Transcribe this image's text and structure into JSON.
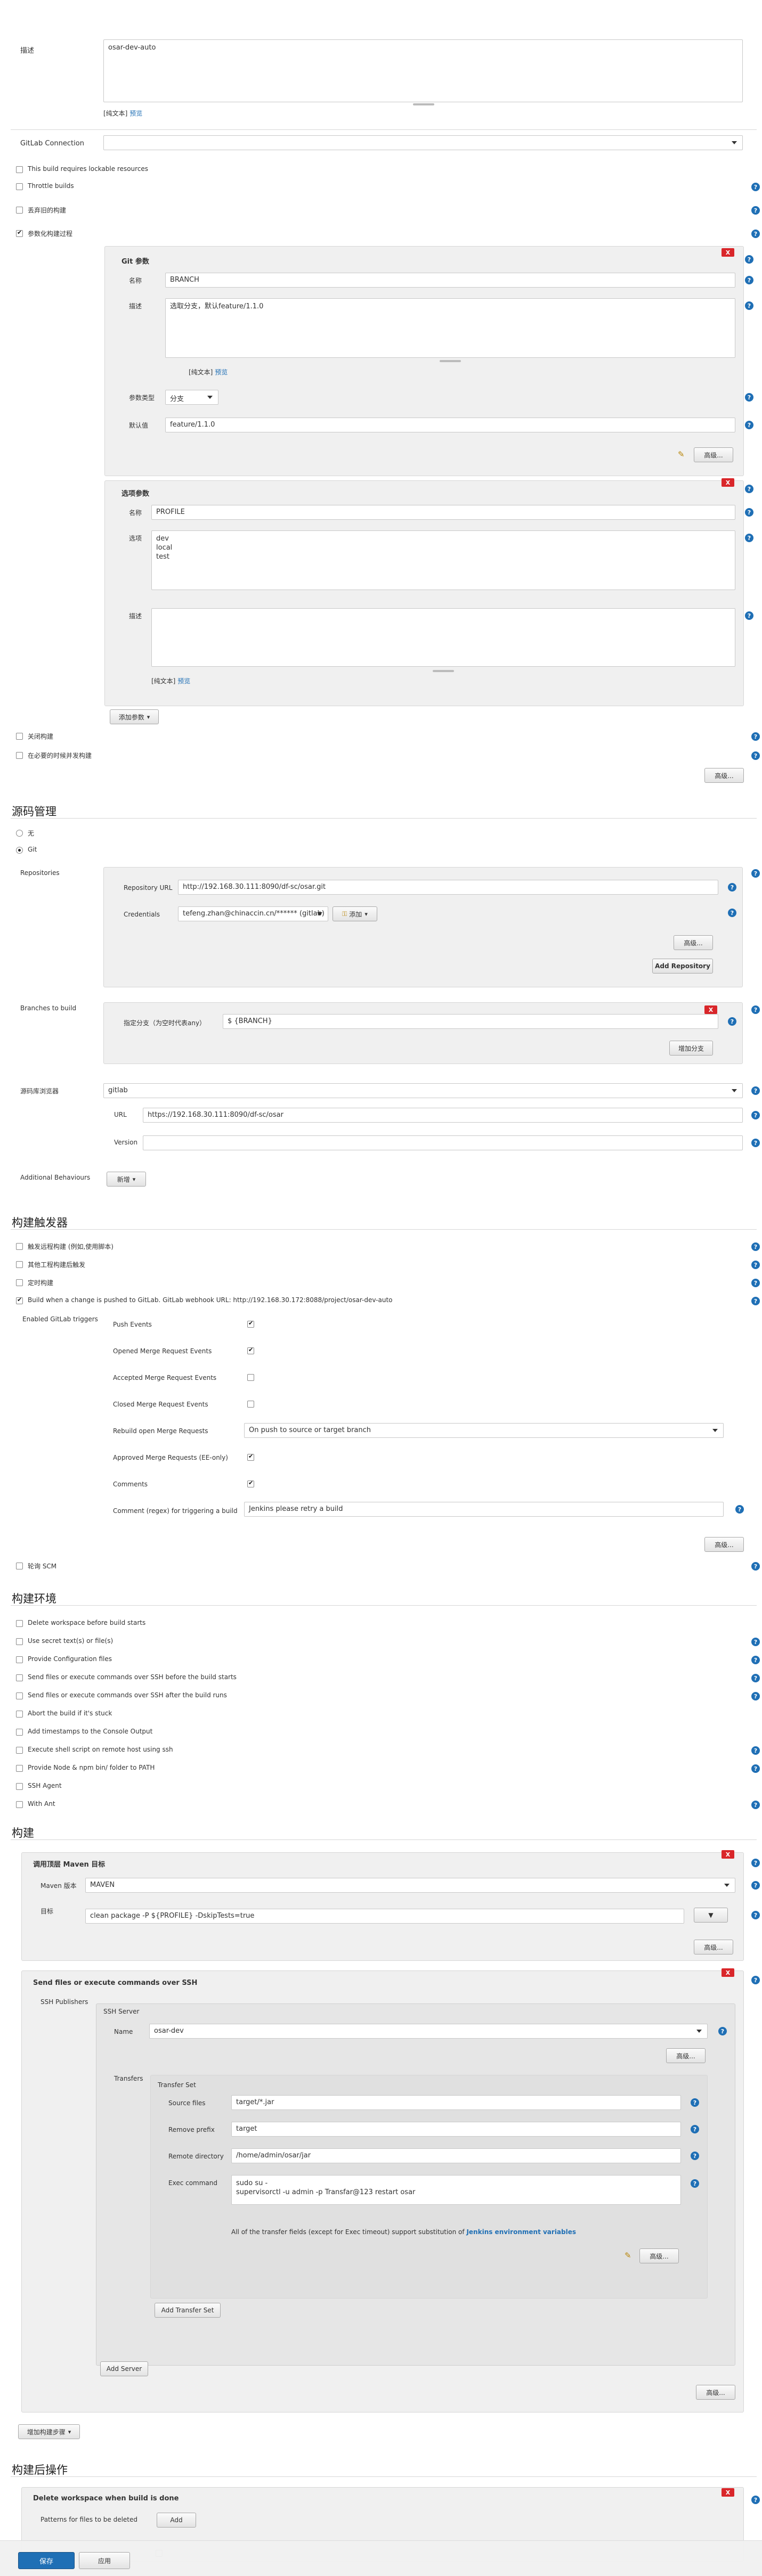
{
  "desc": {
    "label": "描述",
    "value": "osar-dev-auto",
    "plain_text": "[纯文本]",
    "preview": "预览"
  },
  "gitlab_connection": {
    "label": "GitLab Connection",
    "value": ""
  },
  "options": [
    "This build requires lockable resources",
    "Throttle builds",
    "丢弃旧的构建",
    "参数化构建过程"
  ],
  "git_param": {
    "title": "Git 参数",
    "name_label": "名称",
    "name_value": "BRANCH",
    "desc_label": "描述",
    "desc_value": "选取分支，默认feature/1.1.0",
    "plain_text": "[纯文本]",
    "preview": "预览",
    "type_label": "参数类型",
    "type_value": "分支",
    "default_label": "默认值",
    "default_value": "feature/1.1.0",
    "advanced": "高级..."
  },
  "choice_param": {
    "title": "选项参数",
    "name_label": "名称",
    "name_value": "PROFILE",
    "choices_label": "选项",
    "choices_value": "dev\nlocal\ntest",
    "desc_label": "描述",
    "plain_text": "[纯文本]",
    "preview": "预览"
  },
  "add_param": "添加参数",
  "options2": [
    "关闭构建",
    "在必要的时候并发构建"
  ],
  "advanced": "高级...",
  "scm": {
    "heading": "源码管理",
    "none": "无",
    "git": "Git",
    "repositories": "Repositories",
    "repo_url_label": "Repository URL",
    "repo_url": "http://192.168.30.111:8090/df-sc/osar.git",
    "credentials_label": "Credentials",
    "credentials_value": "tefeng.zhan@chinaccin.cn/****** (gitlab)",
    "add_credentials": "添加",
    "add_repository": "Add Repository",
    "branches": "Branches to build",
    "branch_label": "指定分支（为空时代表any）",
    "branch_value": "$ {BRANCH}",
    "add_branch": "增加分支",
    "browser_label": "源码库浏览器",
    "browser_value": "gitlab",
    "url_label": "URL",
    "url_value": "https://192.168.30.111:8090/df-sc/osar",
    "version_label": "Version",
    "additional": "Additional Behaviours",
    "add_behaviour": "新增"
  },
  "triggers": {
    "heading": "构建触发器",
    "items": [
      "触发远程构建 (例如,使用脚本)",
      "其他工程构建后触发",
      "定时构建",
      "Build when a change is pushed to GitLab. GitLab webhook URL: http://192.168.30.172:8088/project/osar-dev-auto"
    ],
    "enabled_label": "Enabled GitLab triggers",
    "push_events": "Push Events",
    "opened_mr": "Opened Merge Request Events",
    "accepted_mr": "Accepted Merge Request Events",
    "closed_mr": "Closed Merge Request Events",
    "rebuild_label": "Rebuild open Merge Requests",
    "rebuild_value": "On push to source or target branch",
    "approved_mr": "Approved Merge Requests (EE-only)",
    "comments": "Comments",
    "comment_regex_label": "Comment (regex) for triggering a build",
    "comment_regex_value": "Jenkins please retry a build",
    "poll_scm": "轮询 SCM"
  },
  "env": {
    "heading": "构建环境",
    "items": [
      "Delete workspace before build starts",
      "Use secret text(s) or file(s)",
      "Provide Configuration files",
      "Send files or execute commands over SSH before the build starts",
      "Send files or execute commands over SSH after the build runs",
      "Abort the build if it's stuck",
      "Add timestamps to the Console Output",
      "Execute shell script on remote host using ssh",
      "Provide Node & npm bin/ folder to PATH",
      "SSH Agent",
      "With Ant"
    ]
  },
  "build": {
    "heading": "构建",
    "maven_title": "调用顶层 Maven 目标",
    "maven_version_label": "Maven 版本",
    "maven_version_value": "MAVEN",
    "goals_label": "目标",
    "goals_value": "clean package -P ${PROFILE} -DskipTests=true",
    "ssh_title": "Send files or execute commands over SSH",
    "ssh_publishers": "SSH Publishers",
    "ssh_server": "SSH Server",
    "name_label": "Name",
    "name_value": "osar-dev",
    "transfers": "Transfers",
    "transfer_set": "Transfer Set",
    "source_files_label": "Source files",
    "source_files_value": "target/*.jar",
    "remove_prefix_label": "Remove prefix",
    "remove_prefix_value": "target",
    "remote_dir_label": "Remote directory",
    "remote_dir_value": "/home/admin/osar/jar",
    "exec_label": "Exec command",
    "exec_value": "sudo su -\nsupervisorctl -u admin -p Transfar@123 restart osar",
    "note": "All of the transfer fields (except for Exec timeout) support substitution of",
    "note_link": "Jenkins environment variables",
    "add_transfer_set": "Add Transfer Set",
    "add_server": "Add Server",
    "add_step": "增加构建步骤"
  },
  "post": {
    "heading": "构建后操作",
    "delete_ws_title": "Delete workspace when build is done",
    "patterns_label": "Patterns for files to be deleted",
    "patterns_btn": "Add"
  },
  "footer": {
    "save": "保存",
    "apply": "应用"
  }
}
